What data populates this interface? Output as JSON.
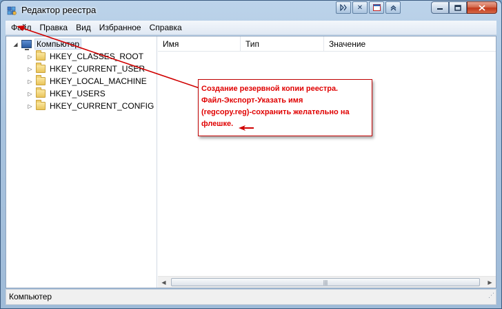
{
  "window": {
    "title": "Редактор реестра"
  },
  "menu": {
    "items": [
      "Файл",
      "Правка",
      "Вид",
      "Избранное",
      "Справка"
    ]
  },
  "tree": {
    "root": "Компьютер",
    "keys": [
      "HKEY_CLASSES_ROOT",
      "HKEY_CURRENT_USER",
      "HKEY_LOCAL_MACHINE",
      "HKEY_USERS",
      "HKEY_CURRENT_CONFIG"
    ]
  },
  "list": {
    "columns": [
      "Имя",
      "Тип",
      "Значение"
    ]
  },
  "status": {
    "path": "Компьютер"
  },
  "annotation": {
    "lines": [
      "Создание резервной копии реестра.",
      "Файл-Экспорт-Указать имя",
      "(regcopy.reg)-сохранить желательно на",
      "флешке."
    ],
    "color": "#e00000"
  },
  "icons": {
    "app": "registry-editor-icon",
    "root": "computer-icon",
    "key": "folder-icon"
  }
}
